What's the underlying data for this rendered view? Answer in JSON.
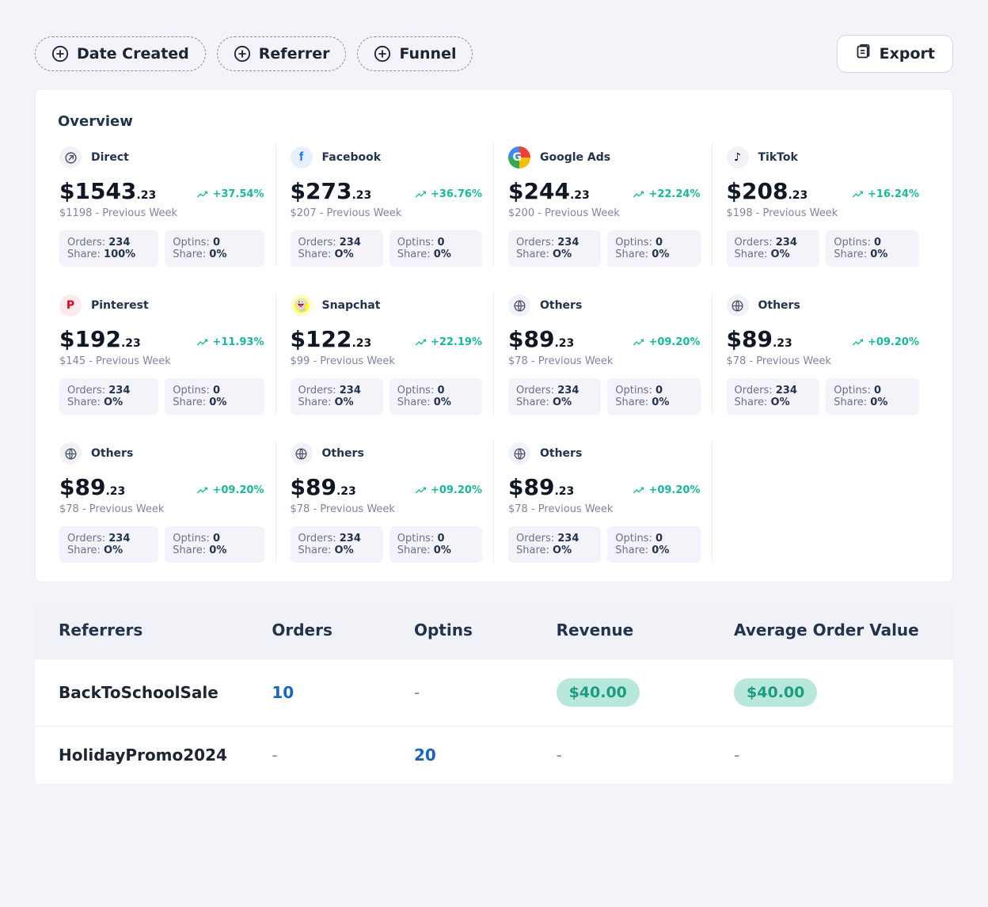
{
  "toolbar": {
    "filters": [
      {
        "label": "Date Created"
      },
      {
        "label": "Referrer"
      },
      {
        "label": "Funnel"
      }
    ],
    "export_label": "Export"
  },
  "overview": {
    "title": "Overview",
    "cards": [
      {
        "icon": "direct",
        "name": "Direct",
        "amount_main": "$1543",
        "amount_cents": ".23",
        "delta": "+37.54%",
        "prev": "$1198 - Previous Week",
        "orders_lbl": "Orders:",
        "orders_val": "234",
        "share_lbl": "Share:",
        "share_val": "100%",
        "optins_lbl": "Optins:",
        "optins_val": "0",
        "share2_lbl": "Share:",
        "share2_val": "0%"
      },
      {
        "icon": "facebook",
        "name": "Facebook",
        "amount_main": "$273",
        "amount_cents": ".23",
        "delta": "+36.76%",
        "prev": "$207 - Previous Week",
        "orders_lbl": "Orders:",
        "orders_val": "234",
        "share_lbl": "Share:",
        "share_val": "O%",
        "optins_lbl": "Optins:",
        "optins_val": "0",
        "share2_lbl": "Share:",
        "share2_val": "0%"
      },
      {
        "icon": "google",
        "name": "Google Ads",
        "amount_main": "$244",
        "amount_cents": ".23",
        "delta": "+22.24%",
        "prev": "$200 - Previous Week",
        "orders_lbl": "Orders:",
        "orders_val": "234",
        "share_lbl": "Share:",
        "share_val": "O%",
        "optins_lbl": "Optins:",
        "optins_val": "0",
        "share2_lbl": "Share:",
        "share2_val": "0%"
      },
      {
        "icon": "tiktok",
        "name": "TikTok",
        "amount_main": "$208",
        "amount_cents": ".23",
        "delta": "+16.24%",
        "prev": "$198 - Previous Week",
        "orders_lbl": "Orders:",
        "orders_val": "234",
        "share_lbl": "Share:",
        "share_val": "O%",
        "optins_lbl": "Optins:",
        "optins_val": "0",
        "share2_lbl": "Share:",
        "share2_val": "0%"
      },
      {
        "icon": "pinterest",
        "name": "Pinterest",
        "amount_main": "$192",
        "amount_cents": ".23",
        "delta": "+11.93%",
        "prev": "$145 - Previous Week",
        "orders_lbl": "Orders:",
        "orders_val": "234",
        "share_lbl": "Share:",
        "share_val": "O%",
        "optins_lbl": "Optins:",
        "optins_val": "0",
        "share2_lbl": "Share:",
        "share2_val": "0%"
      },
      {
        "icon": "snapchat",
        "name": "Snapchat",
        "amount_main": "$122",
        "amount_cents": ".23",
        "delta": "+22.19%",
        "prev": "$99 - Previous Week",
        "orders_lbl": "Orders:",
        "orders_val": "234",
        "share_lbl": "Share:",
        "share_val": "O%",
        "optins_lbl": "Optins:",
        "optins_val": "0",
        "share2_lbl": "Share:",
        "share2_val": "0%"
      },
      {
        "icon": "globe",
        "name": "Others",
        "amount_main": "$89",
        "amount_cents": ".23",
        "delta": "+09.20%",
        "prev": "$78 - Previous Week",
        "orders_lbl": "Orders:",
        "orders_val": "234",
        "share_lbl": "Share:",
        "share_val": "O%",
        "optins_lbl": "Optins:",
        "optins_val": "0",
        "share2_lbl": "Share:",
        "share2_val": "0%"
      },
      {
        "icon": "globe",
        "name": "Others",
        "amount_main": "$89",
        "amount_cents": ".23",
        "delta": "+09.20%",
        "prev": "$78 - Previous Week",
        "orders_lbl": "Orders:",
        "orders_val": "234",
        "share_lbl": "Share:",
        "share_val": "O%",
        "optins_lbl": "Optins:",
        "optins_val": "0",
        "share2_lbl": "Share:",
        "share2_val": "0%"
      },
      {
        "icon": "globe",
        "name": "Others",
        "amount_main": "$89",
        "amount_cents": ".23",
        "delta": "+09.20%",
        "prev": "$78 - Previous Week",
        "orders_lbl": "Orders:",
        "orders_val": "234",
        "share_lbl": "Share:",
        "share_val": "O%",
        "optins_lbl": "Optins:",
        "optins_val": "0",
        "share2_lbl": "Share:",
        "share2_val": "0%"
      },
      {
        "icon": "globe",
        "name": "Others",
        "amount_main": "$89",
        "amount_cents": ".23",
        "delta": "+09.20%",
        "prev": "$78 - Previous Week",
        "orders_lbl": "Orders:",
        "orders_val": "234",
        "share_lbl": "Share:",
        "share_val": "O%",
        "optins_lbl": "Optins:",
        "optins_val": "0",
        "share2_lbl": "Share:",
        "share2_val": "0%"
      },
      {
        "icon": "globe",
        "name": "Others",
        "amount_main": "$89",
        "amount_cents": ".23",
        "delta": "+09.20%",
        "prev": "$78 - Previous Week",
        "orders_lbl": "Orders:",
        "orders_val": "234",
        "share_lbl": "Share:",
        "share_val": "O%",
        "optins_lbl": "Optins:",
        "optins_val": "0",
        "share2_lbl": "Share:",
        "share2_val": "0%"
      }
    ]
  },
  "table": {
    "headers": [
      "Referrers",
      "Orders",
      "Optins",
      "Revenue",
      "Average Order Value"
    ],
    "rows": [
      {
        "referrer": "BackToSchoolSale",
        "orders": "10",
        "optins": "-",
        "revenue": "$40.00",
        "aov": "$40.00"
      },
      {
        "referrer": "HolidayPromo2024",
        "orders": "-",
        "optins": "20",
        "revenue": "-",
        "aov": "-"
      }
    ]
  },
  "colors": {
    "accent_green": "#18b89a",
    "pill_bg": "#b8e7dc",
    "blue": "#1c65b8"
  }
}
